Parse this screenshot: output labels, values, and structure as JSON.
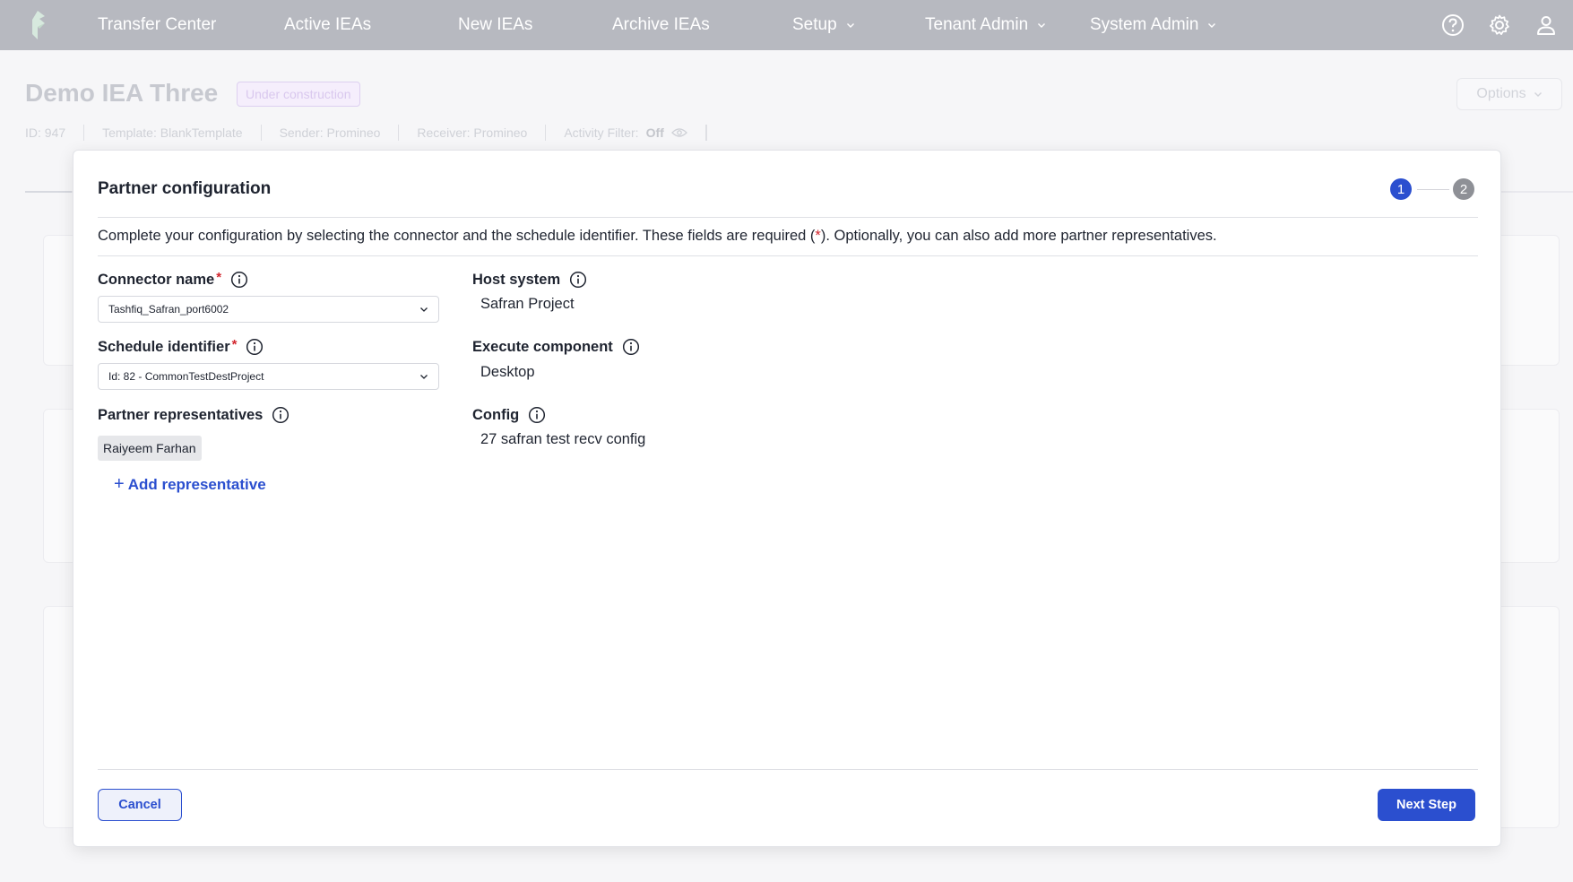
{
  "nav": {
    "items": [
      {
        "label": "Transfer Center",
        "has_dropdown": false
      },
      {
        "label": "Active IEAs",
        "has_dropdown": false
      },
      {
        "label": "New IEAs",
        "has_dropdown": false
      },
      {
        "label": "Archive IEAs",
        "has_dropdown": false
      },
      {
        "label": "Setup",
        "has_dropdown": true
      },
      {
        "label": "Tenant Admin",
        "has_dropdown": true
      },
      {
        "label": "System Admin",
        "has_dropdown": true
      }
    ],
    "icons": [
      "help-icon",
      "settings-gear-icon",
      "user-profile-icon"
    ]
  },
  "background_page": {
    "title": "Demo IEA Three",
    "status": "Under construction",
    "options_label": "Options",
    "meta": {
      "id": "ID: 947",
      "template": "Template: BlankTemplate",
      "sender": "Sender: Promineo",
      "receiver": "Receiver: Promineo",
      "activity_filter_label": "Activity Filter:",
      "activity_filter_value": "Off"
    }
  },
  "modal": {
    "title": "Partner configuration",
    "steps": [
      "1",
      "2"
    ],
    "current_step": 1,
    "description_before": "Complete your configuration by selecting the connector and the schedule identifier. These fields are required (",
    "description_star": "*",
    "description_after": "). Optionally, you can also add more partner representatives.",
    "left": {
      "connector_label": "Connector name",
      "connector_value": "Tashfiq_Safran_port6002",
      "schedule_label": "Schedule identifier",
      "schedule_value": "Id: 82 - CommonTestDestProject",
      "representatives_label": "Partner representatives",
      "representatives": [
        "Raiyeem Farhan"
      ],
      "add_representative_plus": "+",
      "add_representative_label": "Add representative",
      "required_mark": "*"
    },
    "right": {
      "host_system_label": "Host system",
      "host_system_value": "Safran Project",
      "execute_component_label": "Execute component",
      "execute_component_value": "Desktop",
      "config_label": "Config",
      "config_value": "27 safran test recv config"
    },
    "footer": {
      "cancel_label": "Cancel",
      "next_label": "Next Step"
    }
  },
  "colors": {
    "primary": "#2b4fcf",
    "topbar": "#b7b9c0",
    "required": "#d2262e",
    "step_inactive": "#8e9096"
  }
}
